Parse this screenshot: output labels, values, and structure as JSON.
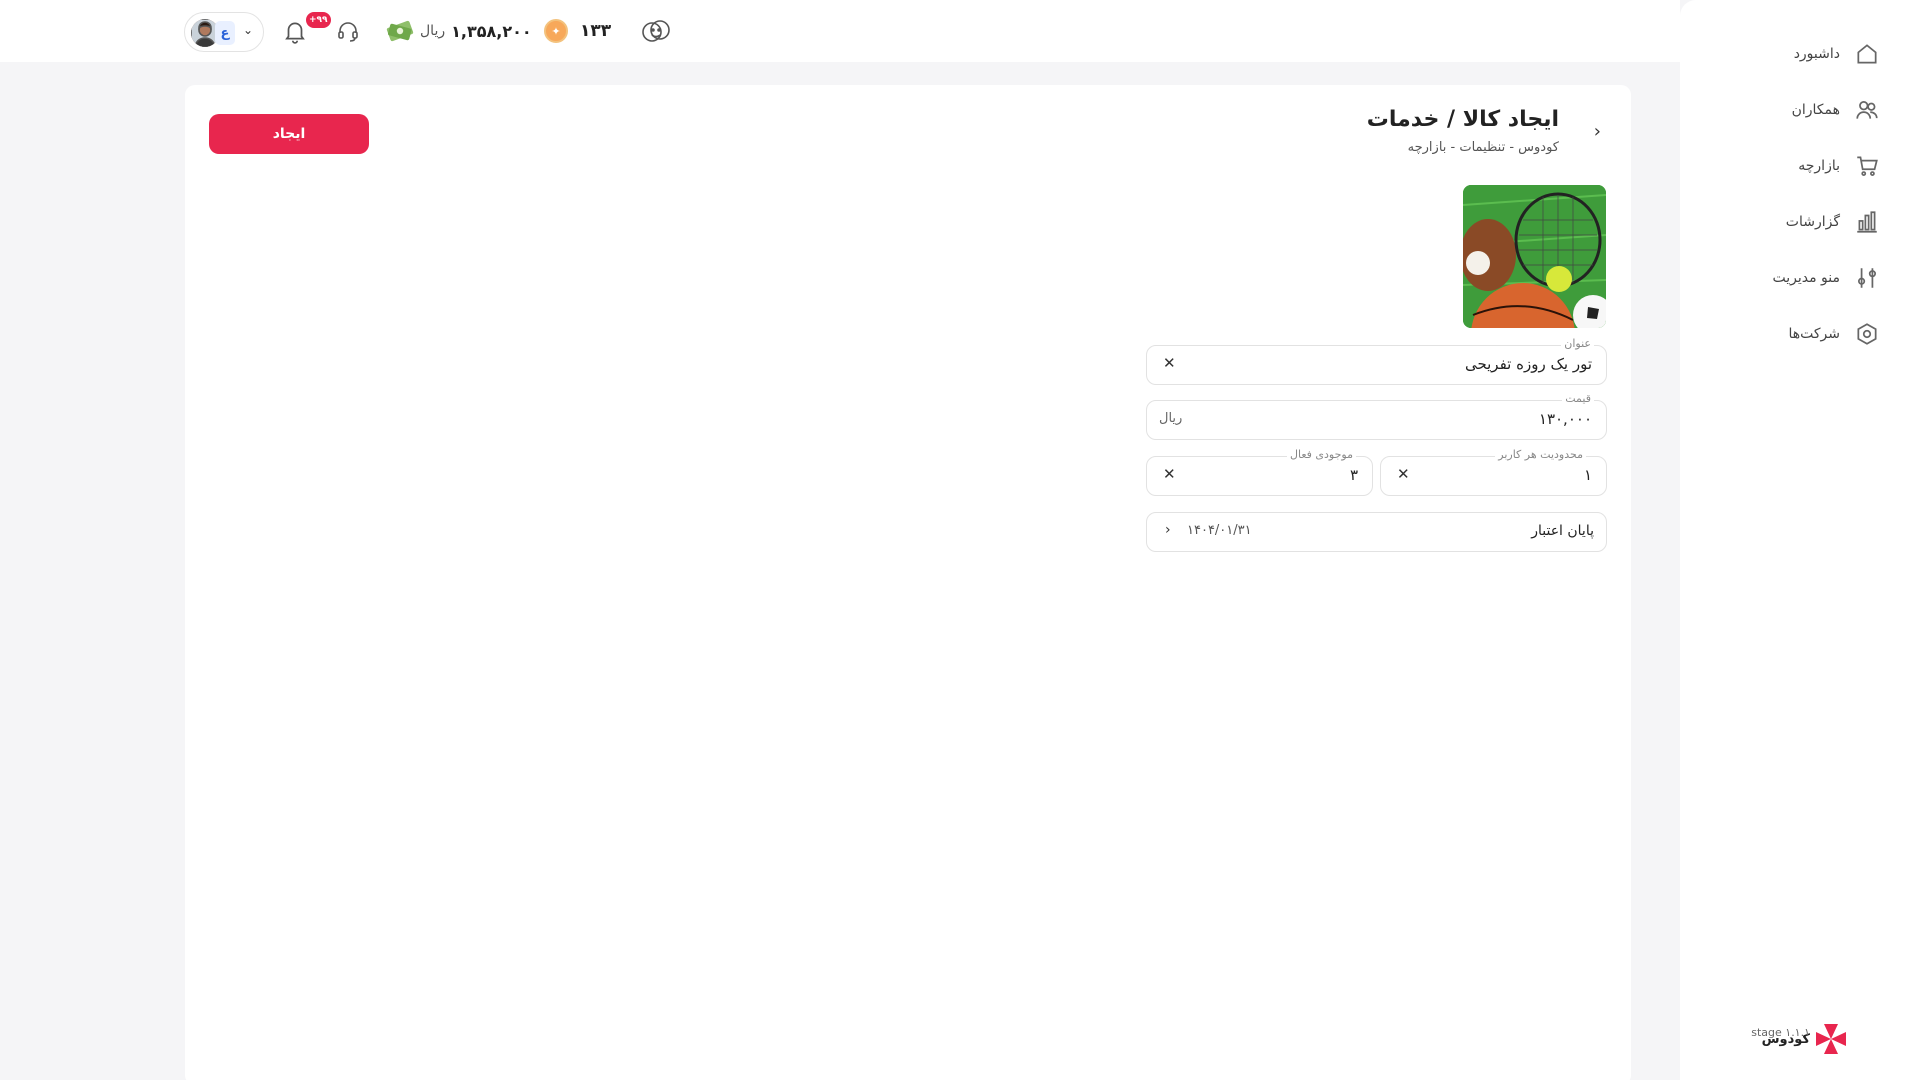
{
  "sidebar": {
    "items": [
      {
        "label": "داشبورد",
        "icon": "home-icon"
      },
      {
        "label": "همکاران",
        "icon": "users-icon"
      },
      {
        "label": "بازارچه",
        "icon": "cart-icon"
      },
      {
        "label": "گزارشات",
        "icon": "bar-chart-icon"
      },
      {
        "label": "منو مدیریت",
        "icon": "sliders-icon"
      },
      {
        "label": "شرکت‌ها",
        "icon": "hexagon-icon"
      }
    ],
    "brand_name": "کودوس",
    "brand_stage": "stage ۱.۱.۱"
  },
  "topbar": {
    "notification_badge": "+۹۹",
    "wallet_amount": "۱,۳۵۸,۲۰۰",
    "wallet_unit": "ریال",
    "coins_count": "۱۳۳",
    "profile_initial": "ع"
  },
  "page": {
    "title": "ایجاد کالا / خدمات",
    "breadcrumb": "کودوس - تنظیمات - بازارچه",
    "create_button": "ایجاد"
  },
  "form": {
    "title_label": "عنوان",
    "title_value": "تور یک روزه تفریحی",
    "price_label": "قیمت",
    "price_value": "۱۳۰,۰۰۰",
    "price_unit": "ریال",
    "user_limit_label": "محدودیت هر کاربر",
    "user_limit_value": "۱",
    "active_inventory_label": "موجودی فعال",
    "active_inventory_value": "۳",
    "expiry_label": "پایان اعتبار",
    "expiry_value": "۱۴۰۴/۰۱/۳۱"
  },
  "colors": {
    "accent": "#e8264e",
    "coin": "#f7a85a"
  }
}
